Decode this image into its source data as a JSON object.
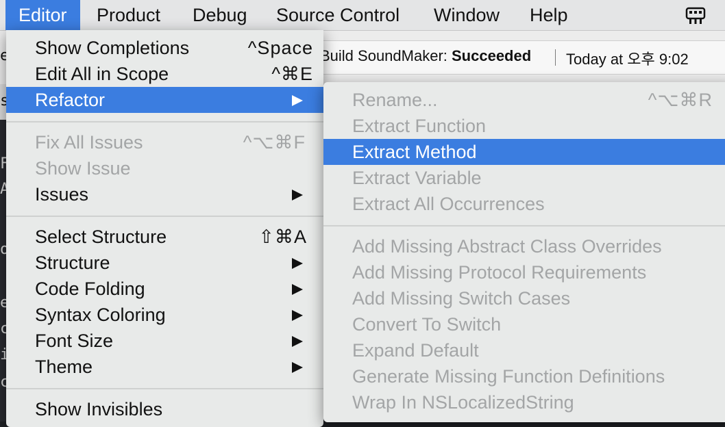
{
  "menubar": {
    "items": [
      "Editor",
      "Product",
      "Debug",
      "Source Control",
      "Window",
      "Help"
    ],
    "active": "Editor",
    "status_icon": "keyboard-input-icon"
  },
  "activity": {
    "prefix": "Build SoundMaker: ",
    "status": "Succeeded",
    "time": "Today at 오후 9:02"
  },
  "background_peek": [
    "er",
    "s",
    "F",
    "A",
    "o",
    "e",
    "c",
    "ir",
    "c"
  ],
  "editor_menu": {
    "items": [
      {
        "label": "Show Completions",
        "shortcut": "^Space"
      },
      {
        "label": "Edit All in Scope",
        "shortcut": "^⌘E"
      },
      {
        "label": "Refactor",
        "submenu": true,
        "selected": true
      },
      {
        "label": "Fix All Issues",
        "shortcut": "^⌥⌘F",
        "disabled": true
      },
      {
        "label": "Show Issue",
        "disabled": true
      },
      {
        "label": "Issues",
        "submenu": true
      },
      {
        "label": "Select Structure",
        "shortcut": "⇧⌘A"
      },
      {
        "label": "Structure",
        "submenu": true
      },
      {
        "label": "Code Folding",
        "submenu": true
      },
      {
        "label": "Syntax Coloring",
        "submenu": true
      },
      {
        "label": "Font Size",
        "submenu": true
      },
      {
        "label": "Theme",
        "submenu": true
      },
      {
        "label": "Show Invisibles"
      }
    ]
  },
  "refactor_menu": {
    "items": [
      {
        "label": "Rename...",
        "shortcut": "^⌥⌘R",
        "disabled": true
      },
      {
        "label": "Extract Function",
        "disabled": true
      },
      {
        "label": "Extract Method",
        "selected": true
      },
      {
        "label": "Extract Variable",
        "disabled": true
      },
      {
        "label": "Extract All Occurrences",
        "disabled": true
      },
      {
        "label": "Add Missing Abstract Class Overrides",
        "disabled": true
      },
      {
        "label": "Add Missing Protocol Requirements",
        "disabled": true
      },
      {
        "label": "Add Missing Switch Cases",
        "disabled": true
      },
      {
        "label": "Convert To Switch",
        "disabled": true
      },
      {
        "label": "Expand Default",
        "disabled": true
      },
      {
        "label": "Generate Missing Function Definitions",
        "disabled": true
      },
      {
        "label": "Wrap In NSLocalizedString",
        "disabled": true
      }
    ]
  },
  "colors": {
    "accent": "#3b7de0",
    "menu_bg": "#e8eae9",
    "disabled_text": "#a3a5a6"
  }
}
